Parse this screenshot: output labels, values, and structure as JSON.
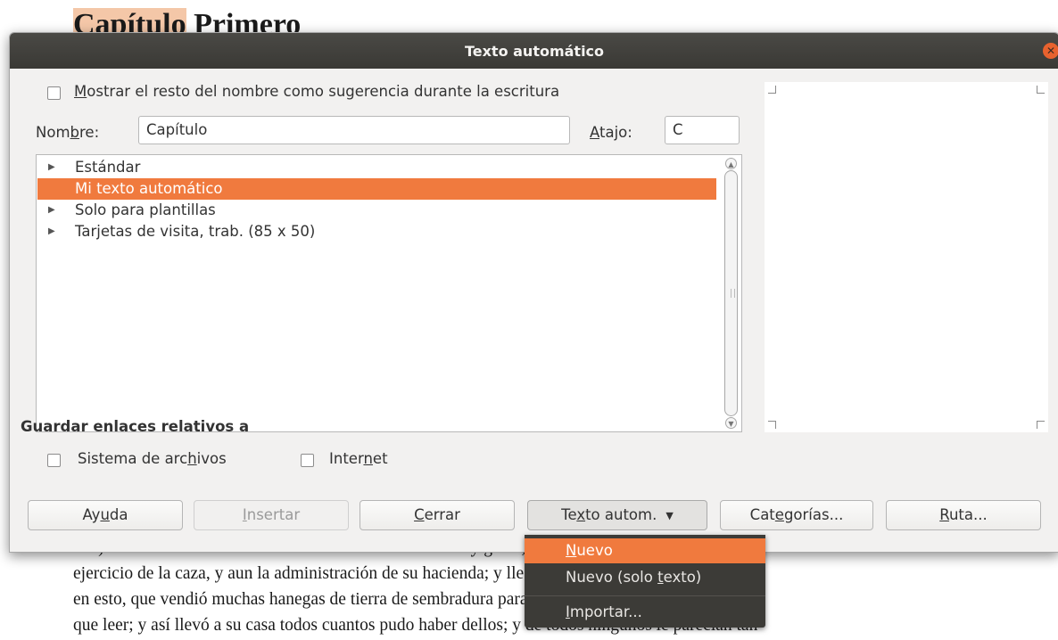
{
  "document": {
    "title_part1": "Capítulo",
    "title_part2": " Primero",
    "lines": [
      "año) se daba a leer libros de caballerías con tanta afición y gusto, que olvidó casi de todo punto el",
      "ejercicio de la caza, y aun la administración de su hacienda; y llegó a tanto su curiosidad y desatino",
      "en esto, que vendió muchas hanegas de tierra de sembradura para comprar libros de caballerías en",
      "que leer; y así llevó a su casa todos cuantos pudo haber dellos; y de todos ningunos le parecían tan"
    ]
  },
  "dialog": {
    "title": "Texto automático",
    "show_rest": {
      "label_first": "M",
      "label_rest": "ostrar el resto del nombre como sugerencia durante la escritura",
      "checked": false
    },
    "name_label_a": "Nom",
    "name_label_b": "b",
    "name_label_c": "re:",
    "name_value": "Capítulo",
    "shortcut_label_a": "A",
    "shortcut_label_b": "tajo:",
    "shortcut_value": "C",
    "tree_items": [
      {
        "label": "Estándar",
        "expandable": true,
        "selected": false
      },
      {
        "label": "Mi texto automático",
        "expandable": false,
        "selected": true
      },
      {
        "label": "Solo para plantillas",
        "expandable": true,
        "selected": false
      },
      {
        "label": "Tarjetas de visita, trab. (85 x 50)",
        "expandable": true,
        "selected": false
      }
    ],
    "relative_links_title": "Guardar enlaces relativos a",
    "filesystem": {
      "label_a": "Sistema de arc",
      "label_b": "h",
      "label_c": "ivos",
      "checked": false
    },
    "internet": {
      "label_a": "Inter",
      "label_b": "n",
      "label_c": "et",
      "checked": false
    },
    "buttons": {
      "help": {
        "a": "Ay",
        "b": "u",
        "c": "da"
      },
      "insert": {
        "a": "",
        "b": "I",
        "c": "nsertar"
      },
      "close": {
        "a": "",
        "b": "C",
        "c": "errar"
      },
      "autotext": {
        "a": "Te",
        "b": "x",
        "c": "to autom."
      },
      "categories": {
        "a": "Cat",
        "b": "e",
        "c": "gorías..."
      },
      "path": {
        "a": "",
        "b": "R",
        "c": "uta..."
      }
    }
  },
  "menu": {
    "new": {
      "a": "",
      "b": "N",
      "c": "uevo"
    },
    "new_text_only": {
      "a": "Nuevo (solo ",
      "b": "t",
      "c": "exto)"
    },
    "import": {
      "a": "",
      "b": "I",
      "c": "mportar..."
    }
  },
  "colors": {
    "accent": "#f07a3e",
    "titlebar": "#3c3b37",
    "dialog_bg": "#f2f1f0"
  }
}
